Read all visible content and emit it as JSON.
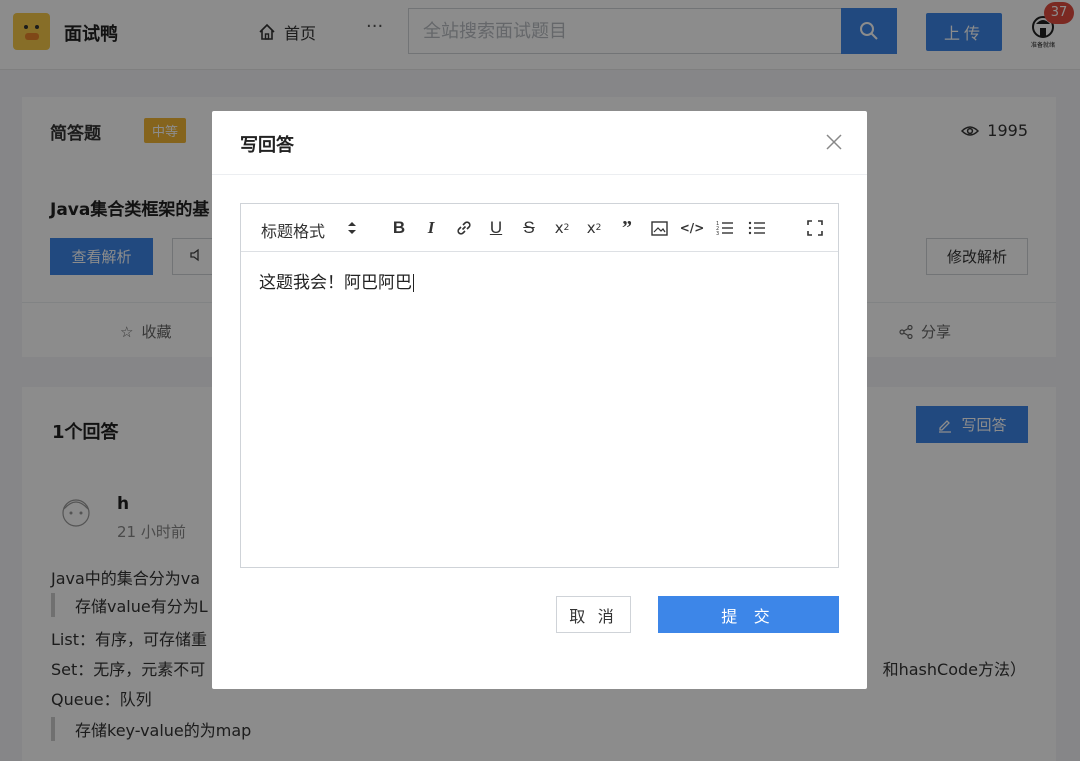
{
  "header": {
    "site_name": "面试鸭",
    "nav_home": "首页",
    "nav_more": "···",
    "search_placeholder": "全站搜索面试题目",
    "upload_label": "上传",
    "notification_count": "37",
    "avatar_caption": "准备就绪"
  },
  "question": {
    "type": "简答题",
    "difficulty": "中等",
    "views": "1995",
    "title": "Java集合类框架的基",
    "view_analysis_label": "查看解析",
    "edit_analysis_label": "修改解析",
    "favorite_label": "收藏",
    "share_label": "分享"
  },
  "answers": {
    "count_label": "1个回答",
    "write_label": "写回答",
    "user": "h",
    "time": "21 小时前",
    "lines": [
      "Java中的集合分为va",
      "存储value有分为L",
      "List：有序，可存储重",
      "Set：无序，元素不可",
      "Queue：队列",
      "存储key-value的为map"
    ],
    "line_right": "和hashCode方法）"
  },
  "modal": {
    "title": "写回答",
    "heading_format": "标题格式",
    "content": "这题我会！阿巴阿巴",
    "cancel_label": "取 消",
    "submit_label": "提 交"
  },
  "colors": {
    "primary": "#3d86e8",
    "difficulty": "#f2b635",
    "badge": "#e04b3f"
  }
}
